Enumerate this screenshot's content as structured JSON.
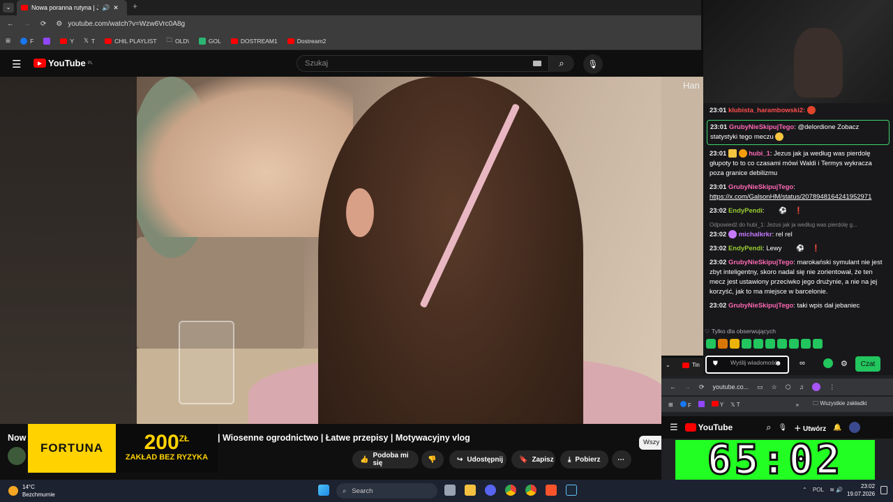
{
  "browser": {
    "tab_title": "Nowa poranna rutyna | Jak",
    "url": "youtube.com/watch?v=Wzw6Vrc0A8g",
    "bookmarks": [
      "F",
      "",
      "Y",
      "T",
      "CHIL PLAYLIST",
      "OLD\\",
      "GOL",
      "DOSTREAM1",
      "Dostream2"
    ]
  },
  "youtube": {
    "logo": "YouTube",
    "country": "PL",
    "search_placeholder": "Szukaj",
    "overlay_text": "Han",
    "title_left": "Now",
    "title": "| Wiosenne ogrodnictwo | Łatwe przepisy | Motywacyjny vlog",
    "actions": {
      "like": "Podoba mi się",
      "share": "Udostępnij",
      "save": "Zapisz",
      "download": "Pobierz"
    },
    "wszy": "Wszy"
  },
  "ad": {
    "brand": "FORTUNA",
    "amount": "200",
    "currency": "ZŁ",
    "tagline": "ZAKŁAD BEZ RYZYKA"
  },
  "chat": {
    "messages": [
      {
        "time": "23:01",
        "user": "klubista_harambowski2:",
        "text": ""
      },
      {
        "time": "23:01",
        "user": "GrubyNieSkipujTego",
        "text": ": @delordione Zobacz statystyki tego meczu"
      },
      {
        "time": "23:01",
        "user": "hubi_1",
        "text": ": Jezus jak ja według was pierdolę głupoty to to co czasami mówi Waldi i Termys wykracza poza granice debilizmu"
      },
      {
        "time": "23:01",
        "user": "GrubyNieSkipujTego",
        "text": ":",
        "link": "https://x.com/GalsonHM/status/2078948164241952971"
      },
      {
        "time": "23:02",
        "user": "EndyPendi",
        "text": ":"
      },
      {
        "reply": "Odpowiedź do hubi_1: Jezus jak ja według was pierdolę g..."
      },
      {
        "time": "23:02",
        "user": "michalkrkr",
        "text": ": rel rel"
      },
      {
        "time": "23:02",
        "user": "EndyPendi",
        "text": ": Lewy"
      },
      {
        "time": "23:02",
        "user": "GrubyNieSkipujTego",
        "text": ": marokański symulant nie jest zbyt inteligentny, skoro nadal się nie zorientował, że ten mecz jest ustawiony przeciwko jego drużynie, a nie na jej korzyść, jak to ma miejsce w barcelonie."
      },
      {
        "time": "23:02",
        "user": "GrubyNieSkipujTego",
        "text": ": taki wpis dał jebaniec"
      }
    ],
    "followers_only": "Tylko dla obserwujących",
    "input_placeholder": "Wyślij wiadomość",
    "send_button": "Czat"
  },
  "mini_browser": {
    "tab": "Tin",
    "url": "youtube.co...",
    "bookmarks": [
      "F",
      "",
      "Y",
      "T"
    ],
    "all_bookmarks": "Wszystkie zakładki",
    "create": "Utwórz",
    "clock": "65:02"
  },
  "taskbar": {
    "temperature": "14°C",
    "weather": "Bezchmurnie",
    "search": "Search",
    "language": "POL",
    "time": "23:02",
    "date": "19.07.2026"
  },
  "colors": {
    "youtube_red": "#ff0000",
    "chat_accent": "#22c55e",
    "clock_bg": "#22ff22"
  }
}
